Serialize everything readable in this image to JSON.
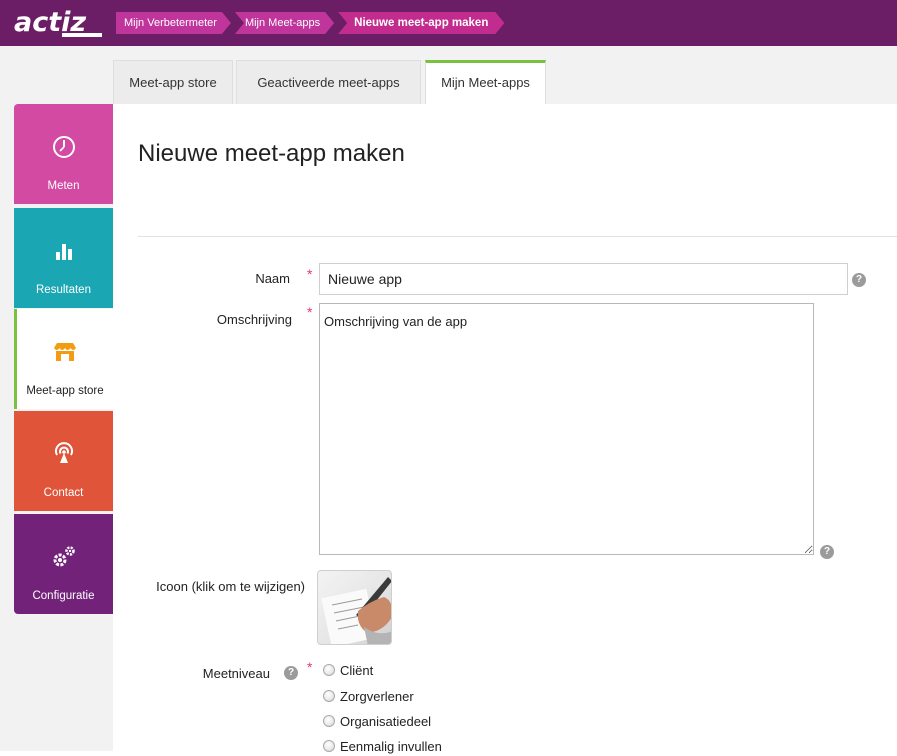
{
  "header": {
    "logo": "actiz",
    "breadcrumbs": [
      "Mijn Verbetermeter",
      "Mijn Meet-apps",
      "Nieuwe meet-app maken"
    ]
  },
  "tabs": [
    {
      "label": "Meet-app store",
      "active": false
    },
    {
      "label": "Geactiveerde meet-apps",
      "active": false
    },
    {
      "label": "Mijn Meet-apps",
      "active": true
    }
  ],
  "sidebar": {
    "items": [
      {
        "label": "Meten",
        "icon": "clock-icon",
        "color": "#d24aa2"
      },
      {
        "label": "Resultaten",
        "icon": "bar-chart-icon",
        "color": "#1aa6b2"
      },
      {
        "label": "Meet-app store",
        "icon": "store-icon",
        "color": "#f39c12",
        "active": true
      },
      {
        "label": "Contact",
        "icon": "broadcast-icon",
        "color": "#e0553a"
      },
      {
        "label": "Configuratie",
        "icon": "gears-icon",
        "color": "#73227a"
      }
    ]
  },
  "main": {
    "title": "Nieuwe meet-app maken",
    "form": {
      "naam_label": "Naam",
      "naam_value": "Nieuwe app",
      "omschrijving_label": "Omschrijving",
      "omschrijving_value": "Omschrijving van de app",
      "icoon_label": "Icoon (klik om te wijzigen)",
      "meetniveau_label": "Meetniveau",
      "required_mark": "*",
      "help_mark": "?",
      "meetniveau_options": [
        "Cliënt",
        "Zorgverlener",
        "Organisatiedeel",
        "Eenmalig invullen"
      ]
    }
  },
  "colors": {
    "topbar": "#6b1d66",
    "breadcrumb": "#c0359b",
    "active_tab_accent": "#7ac142",
    "required": "#e8347d"
  }
}
